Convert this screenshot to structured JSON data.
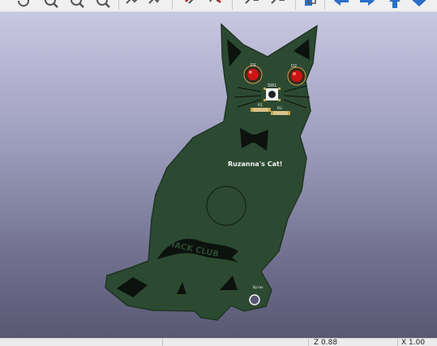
{
  "toolbar": {
    "buttons": [
      {
        "name": "undo-button",
        "icon": "undo-icon"
      },
      {
        "name": "zoom-in-button",
        "icon": "zoom-in-icon"
      },
      {
        "name": "zoom-out-button",
        "icon": "zoom-out-icon"
      },
      {
        "name": "zoom-fit-button",
        "icon": "zoom-fit-icon"
      },
      {
        "name": "route-track-button",
        "icon": "route-track-icon"
      },
      {
        "name": "route-diff-pair-button",
        "icon": "route-diff-pair-icon"
      },
      {
        "name": "delete-tool-button",
        "icon": "delete-tool-icon"
      },
      {
        "name": "drc-button",
        "icon": "drc-icon"
      },
      {
        "name": "flip-z-button",
        "icon": "flip-z-icon"
      },
      {
        "name": "flip-z2-button",
        "icon": "flip-z2-icon"
      },
      {
        "name": "layer-button",
        "icon": "layer-icon"
      },
      {
        "name": "view-left-button",
        "icon": "arrow-left-icon"
      },
      {
        "name": "view-right-button",
        "icon": "arrow-right-icon"
      },
      {
        "name": "view-up-button",
        "icon": "arrow-up-icon"
      },
      {
        "name": "view-down-button",
        "icon": "arrow-down-icon"
      }
    ],
    "z_label": "Z"
  },
  "board": {
    "silkscreen_text": "Ruzanna's Cat!",
    "logo_text": "HACK CLUB",
    "ref_d1": "D1",
    "ref_d2": "D2",
    "ref_sw1": "SW1",
    "ref_r1": "R1",
    "ref_r2": "R2",
    "small_label": "By'rex",
    "colors": {
      "board": "#2c4a31",
      "board_edge": "#1f3524",
      "silk_white": "#f2f2f2",
      "black": "#0c120d",
      "led_red": "#cc1414",
      "pad_gold": "#c9a54a"
    }
  },
  "status": {
    "zoom": "Z 0.88",
    "coord": "X 1.00"
  }
}
